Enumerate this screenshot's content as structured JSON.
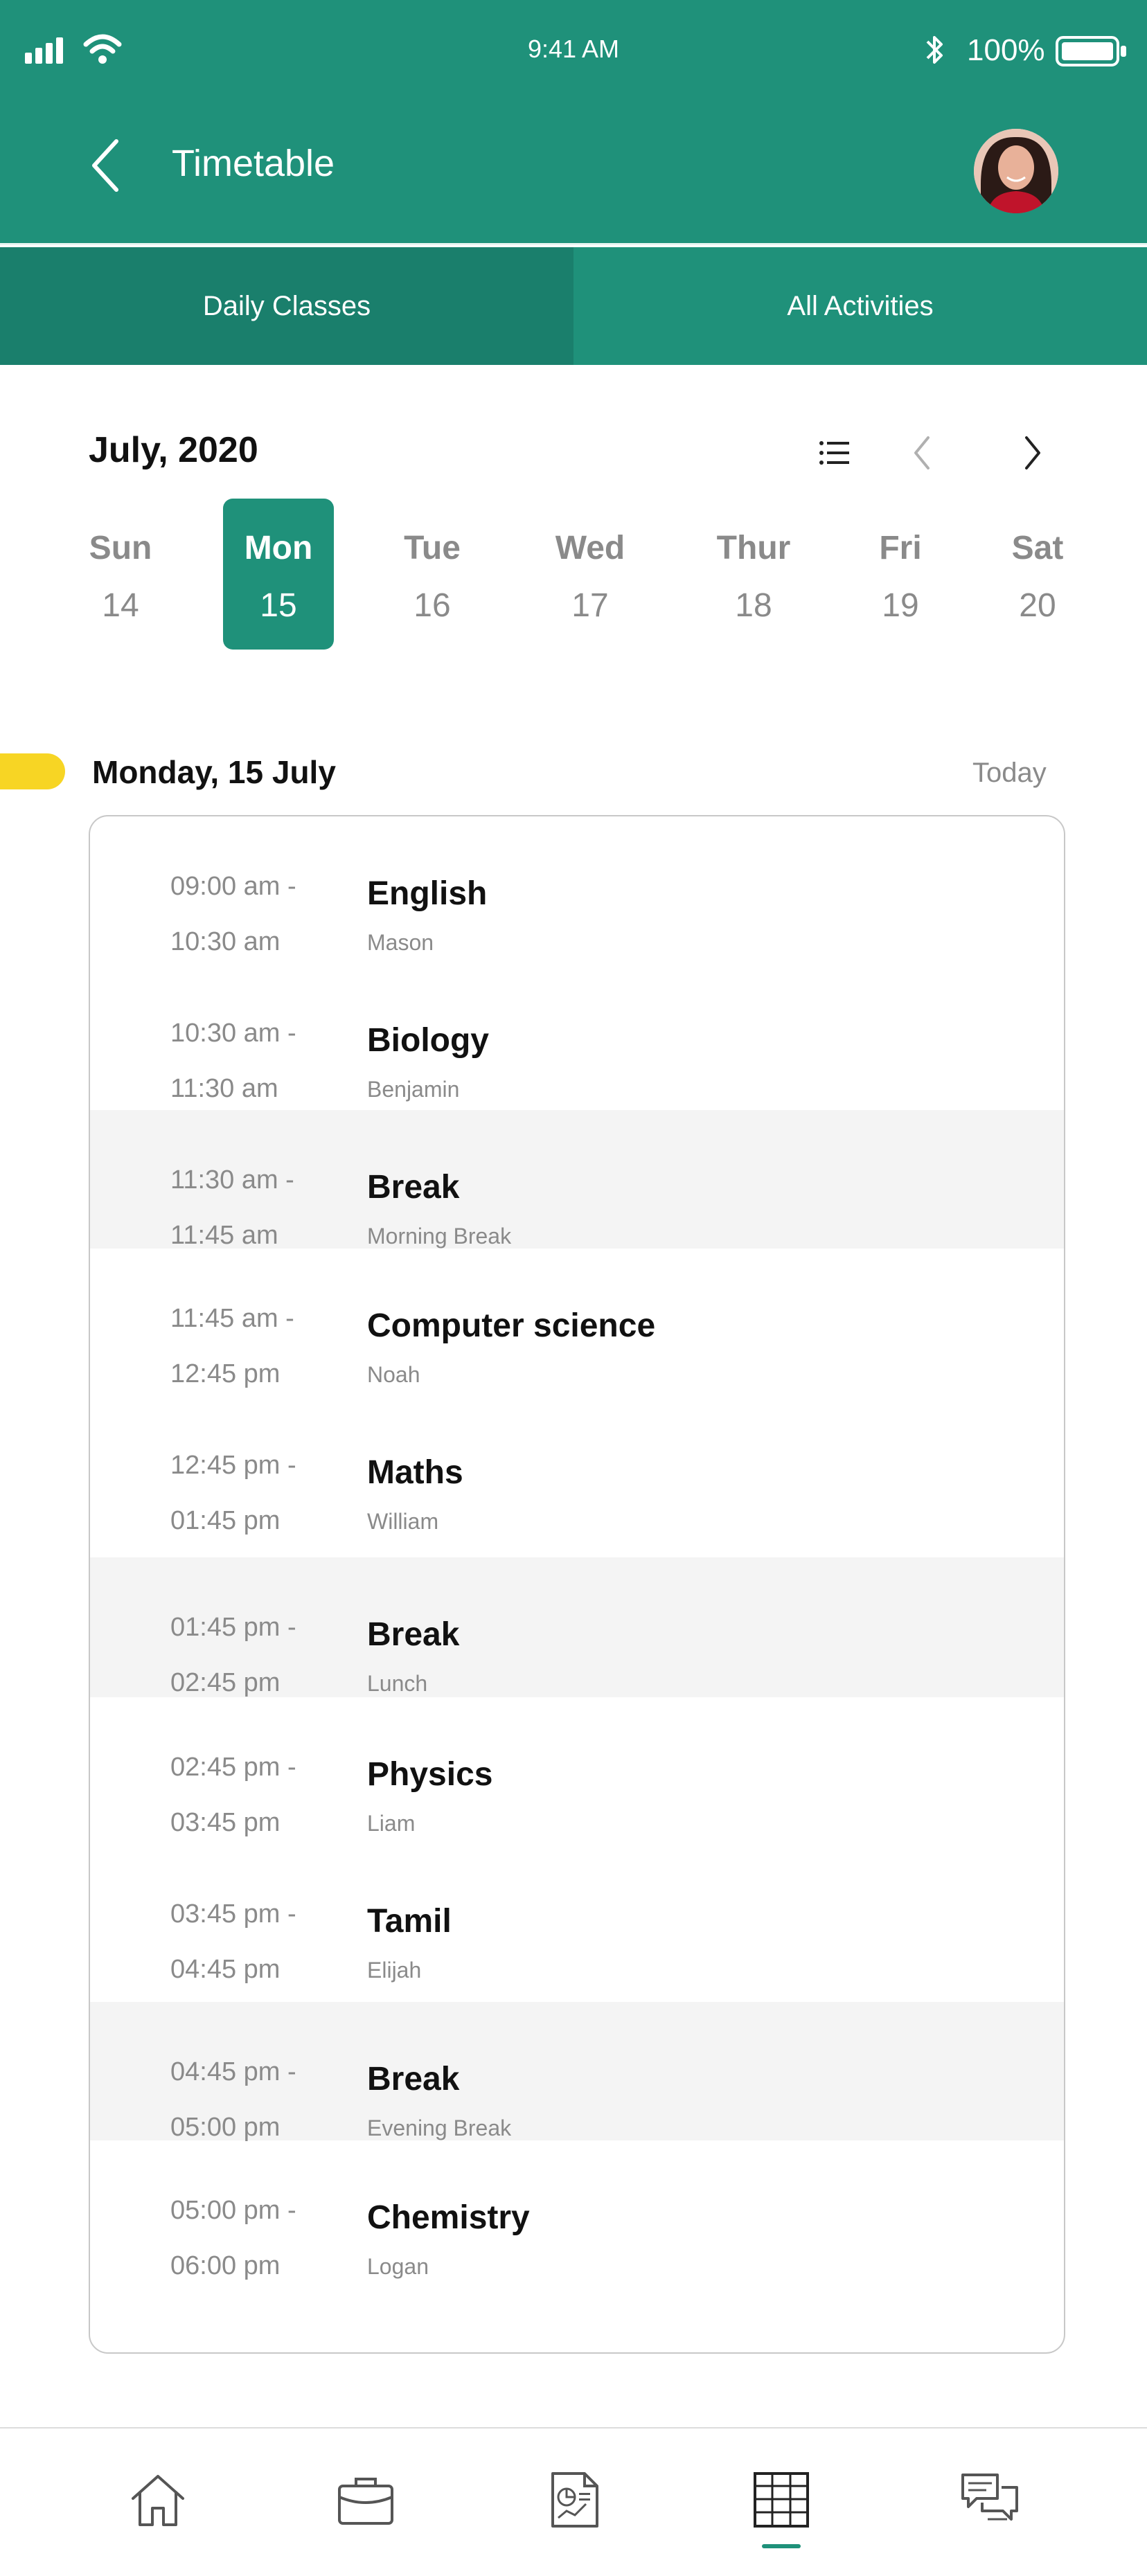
{
  "status_bar": {
    "time": "9:41 AM",
    "battery": "100%"
  },
  "header": {
    "title": "Timetable"
  },
  "tabs": [
    {
      "label": "Daily Classes",
      "active": true
    },
    {
      "label": "All Activities",
      "active": false
    }
  ],
  "calendar": {
    "month": "July, 2020",
    "days": [
      {
        "name": "Sun",
        "date": "14"
      },
      {
        "name": "Mon",
        "date": "15",
        "selected": true
      },
      {
        "name": "Tue",
        "date": "16"
      },
      {
        "name": "Wed",
        "date": "17"
      },
      {
        "name": "Thur",
        "date": "18"
      },
      {
        "name": "Fri",
        "date": "19"
      },
      {
        "name": "Sat",
        "date": "20"
      }
    ]
  },
  "schedule": {
    "date_heading": "Monday, 15 July",
    "today_label": "Today",
    "items": [
      {
        "start": "09:00 am -",
        "end": "10:30 am",
        "subject": "English",
        "teacher": "Mason",
        "break": false
      },
      {
        "start": "10:30 am -",
        "end": "11:30 am",
        "subject": "Biology",
        "teacher": "Benjamin",
        "break": false
      },
      {
        "start": "11:30 am -",
        "end": "11:45 am",
        "subject": "Break",
        "teacher": "Morning Break",
        "break": true
      },
      {
        "start": "11:45 am -",
        "end": "12:45 pm",
        "subject": "Computer science",
        "teacher": "Noah",
        "break": false
      },
      {
        "start": "12:45 pm -",
        "end": "01:45 pm",
        "subject": "Maths",
        "teacher": "William",
        "break": false
      },
      {
        "start": "01:45 pm -",
        "end": "02:45 pm",
        "subject": "Break",
        "teacher": "Lunch",
        "break": true
      },
      {
        "start": "02:45 pm -",
        "end": "03:45 pm",
        "subject": "Physics",
        "teacher": "Liam",
        "break": false
      },
      {
        "start": "03:45 pm -",
        "end": "04:45 pm",
        "subject": "Tamil",
        "teacher": "Elijah",
        "break": false
      },
      {
        "start": "04:45 pm -",
        "end": "05:00 pm",
        "subject": "Break",
        "teacher": "Evening Break",
        "break": true
      },
      {
        "start": "05:00 pm -",
        "end": "06:00 pm",
        "subject": "Chemistry",
        "teacher": "Logan",
        "break": false
      }
    ]
  },
  "bottom_nav": {
    "items": [
      {
        "icon": "home-icon",
        "active": false
      },
      {
        "icon": "briefcase-icon",
        "active": false
      },
      {
        "icon": "report-icon",
        "active": false
      },
      {
        "icon": "timetable-icon",
        "active": true
      },
      {
        "icon": "chat-icon",
        "active": false
      }
    ]
  },
  "colors": {
    "primary": "#1f917a",
    "primary_dark": "#1a7f6c",
    "accent": "#f7d524",
    "break_bg": "#f4f4f4"
  }
}
